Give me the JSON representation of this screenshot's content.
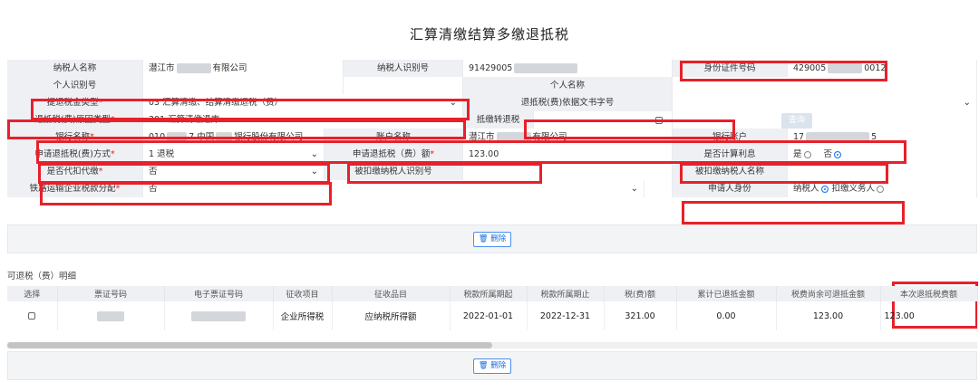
{
  "page_title": "汇算清缴结算多缴退抵税",
  "form": {
    "taxpayer_name_label": "纳税人名称",
    "taxpayer_name_prefix": "潜江市",
    "taxpayer_name_suffix": "有限公司",
    "taxpayer_id_label": "纳税人识别号",
    "taxpayer_id_value": "91429005",
    "id_doc_label": "身份证件号码",
    "id_doc_prefix": "429005",
    "id_doc_suffix": "0012",
    "personal_id_label": "个人识别号",
    "personal_name_label": "个人名称",
    "refund_type_label": "提退税金类型",
    "refund_type_value": "03 汇算清缴、结算清缴退税（费）",
    "refund_basis_label": "退抵税(费)依据文书字号",
    "refund_reason_label": "退抵税(费)原因类型",
    "refund_reason_value": "301 汇算清缴退库",
    "offset_label": "抵缴转退税",
    "query_label": "查询",
    "bank_name_label": "银行名称",
    "bank_name_prefix": "010",
    "bank_name_mid": "7 中国",
    "bank_name_suffix": "银行股份有限公司",
    "account_name_label": "账户名称",
    "account_name_prefix": "潜江市",
    "account_name_suffix": "有限公司",
    "bank_account_label": "银行账户",
    "bank_account_prefix": "17",
    "bank_account_suffix": "5",
    "apply_method_label": "申请退抵税(费)方式",
    "apply_method_value": "1 退税",
    "apply_amount_label": "申请退抵税（费）额",
    "apply_amount_value": "123.00",
    "calc_interest_label": "是否计算利息",
    "yes_label": "是",
    "no_label": "否",
    "withhold_label": "是否代扣代缴",
    "withhold_value": "否",
    "withheld_id_label": "被扣缴纳税人识别号",
    "withheld_name_label": "被扣缴纳税人名称",
    "railway_label": "铁路运输企业税款分配",
    "railway_value": "否",
    "applicant_label": "申请人身份",
    "applicant_taxpayer": "纳税人",
    "applicant_withholder": "扣缴义务人",
    "required_mark": "*"
  },
  "delete_label": "删除",
  "detail": {
    "section_title": "可退税（费）明细",
    "headers": [
      "选择",
      "票证号码",
      "电子票证号码",
      "征收项目",
      "征收品目",
      "税款所属期起",
      "税款所属期止",
      "税(费)额",
      "累计已退抵金额",
      "税费尚余可退抵金额",
      "本次退抵税费额"
    ],
    "row": {
      "item": "企业所得税",
      "subitem": "应纳税所得额",
      "start": "2022-01-01",
      "end": "2022-12-31",
      "tax": "321.00",
      "refunded": "0.00",
      "remaining": "123.00",
      "this_refund": "123.00"
    }
  },
  "icons": [
    "trash-icon",
    "chevron-down-icon",
    "radio-icon",
    "checkbox-icon"
  ],
  "colors": {
    "highlight": "#e8202a",
    "label_bg": "#eef0f4",
    "accent": "#1677ff"
  }
}
